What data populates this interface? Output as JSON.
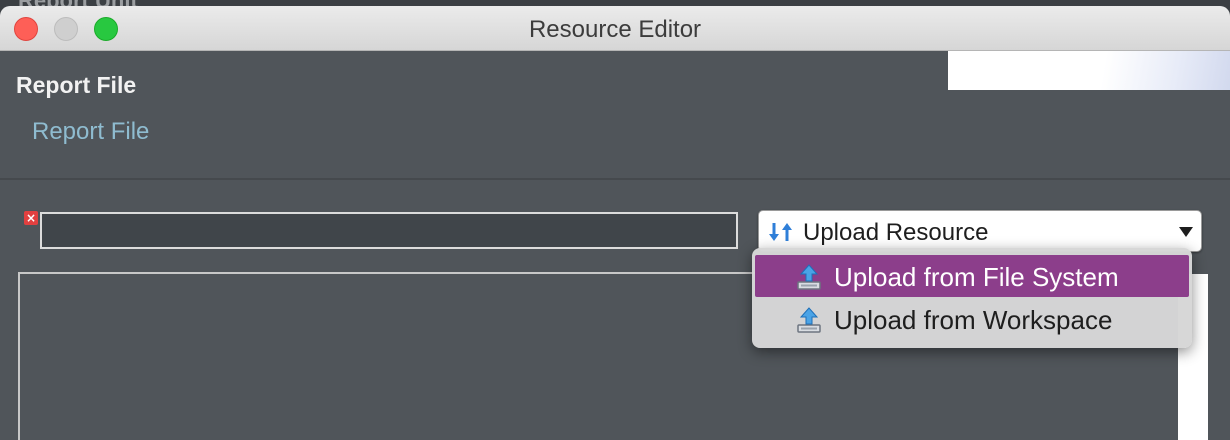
{
  "background_window": {
    "title_fragment": "Report Unit"
  },
  "window": {
    "title": "Resource Editor"
  },
  "section": {
    "title": "Report File",
    "subtitle": "Report File"
  },
  "path_field": {
    "value": "",
    "has_error": true
  },
  "resource_dropdown": {
    "selected": "Upload Resource",
    "options": [
      {
        "label": "Upload from File System",
        "icon": "upload-icon",
        "highlighted": true
      },
      {
        "label": "Upload from Workspace",
        "icon": "upload-icon",
        "highlighted": false
      }
    ]
  },
  "colors": {
    "window_bg": "#50555a",
    "subtitle": "#8fbcd0",
    "menu_highlight": "#8c3e8b",
    "error": "#e24040"
  }
}
